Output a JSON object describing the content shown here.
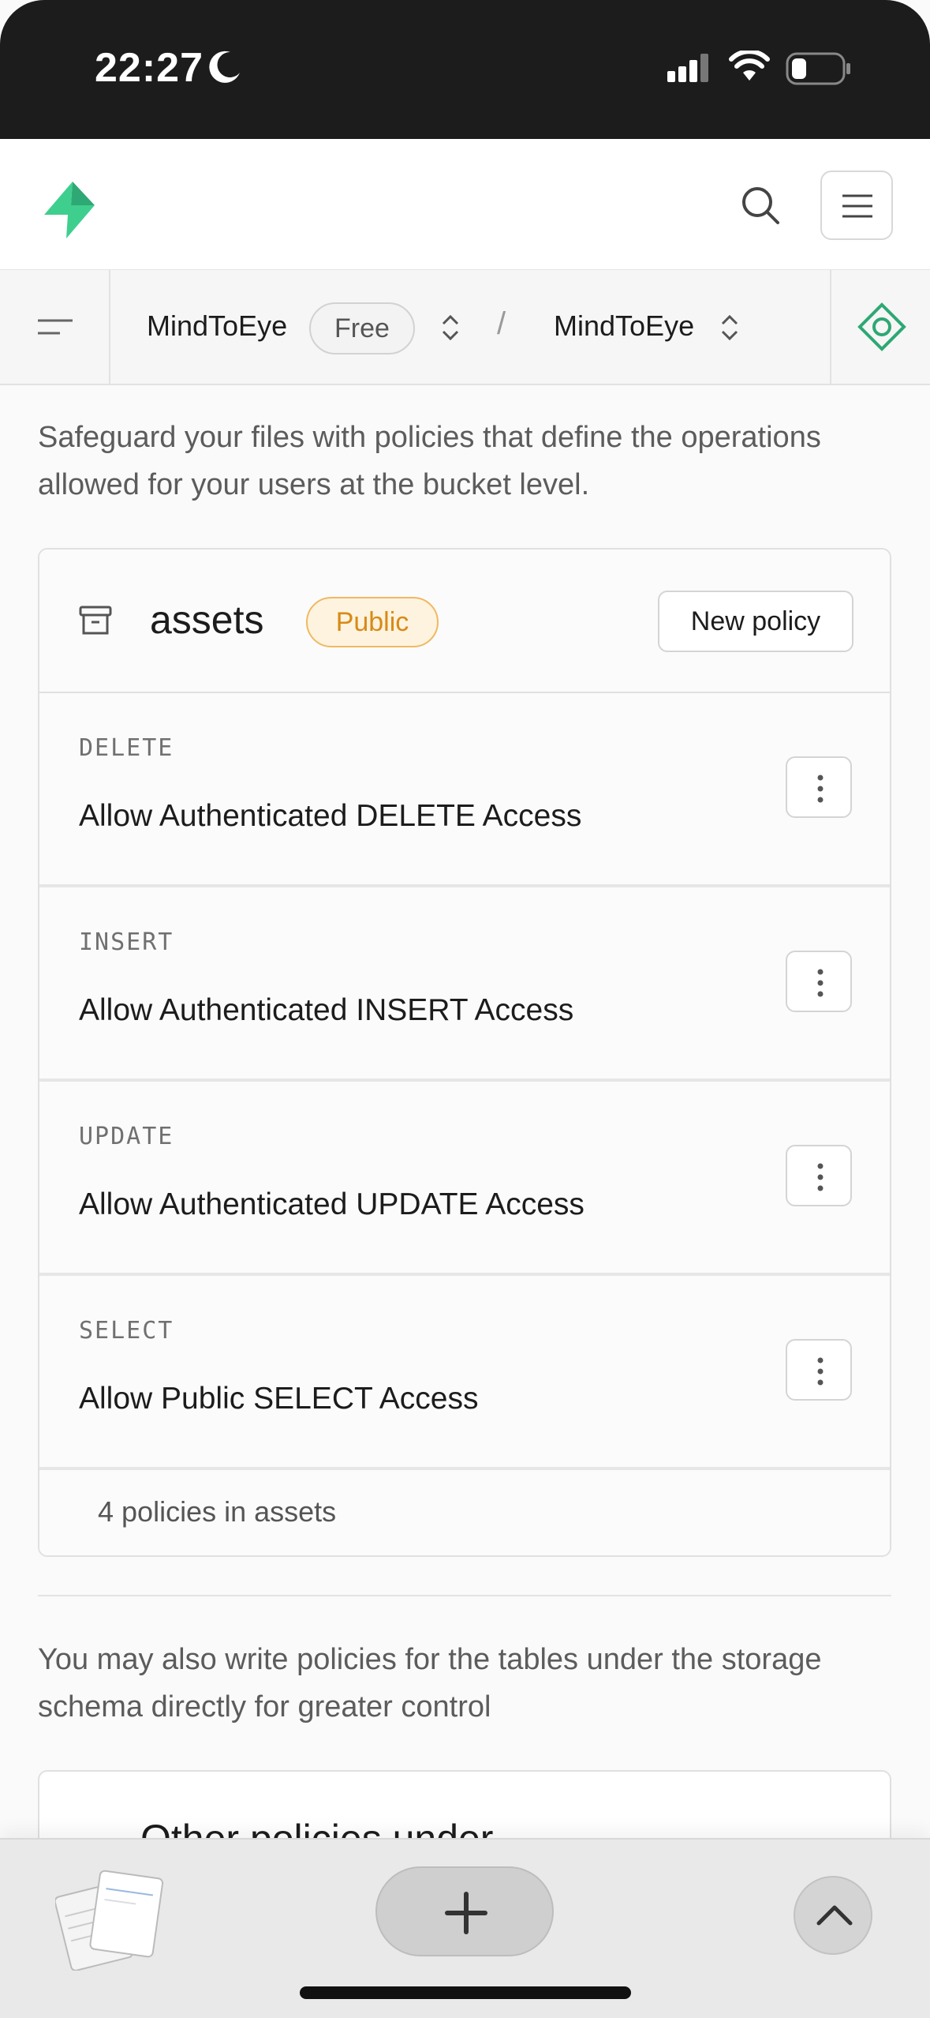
{
  "status_bar": {
    "time": "22:27"
  },
  "header": {},
  "breadcrumb": {
    "org": "MindToEye",
    "plan_badge": "Free",
    "separator": "/",
    "project": "MindToEye"
  },
  "content": {
    "description": "Safeguard your files with policies that define the operations allowed for your users at the bucket level.",
    "bucket": {
      "name": "assets",
      "visibility_badge": "Public",
      "new_policy_label": "New policy",
      "policies": [
        {
          "operation": "DELETE",
          "name": "Allow Authenticated DELETE Access"
        },
        {
          "operation": "INSERT",
          "name": "Allow Authenticated INSERT Access"
        },
        {
          "operation": "UPDATE",
          "name": "Allow Authenticated UPDATE Access"
        },
        {
          "operation": "SELECT",
          "name": "Allow Public SELECT Access"
        }
      ],
      "footer": "4 policies in assets"
    },
    "description2": "You may also write policies for the tables under the storage schema directly for greater control",
    "other_card_title": "Other policies under"
  },
  "colors": {
    "brand_green": "#3ecf8e",
    "public_badge": "#d88a16"
  },
  "icons": [
    "moon-icon",
    "signal-icon",
    "wifi-icon",
    "battery-icon",
    "supabase-logo",
    "search-icon",
    "menu-icon",
    "sidebar-toggle-icon",
    "chevron-updown-icon",
    "connect-icon",
    "bucket-archive-icon",
    "more-vertical-icon",
    "plus-icon",
    "chevron-up-icon"
  ]
}
